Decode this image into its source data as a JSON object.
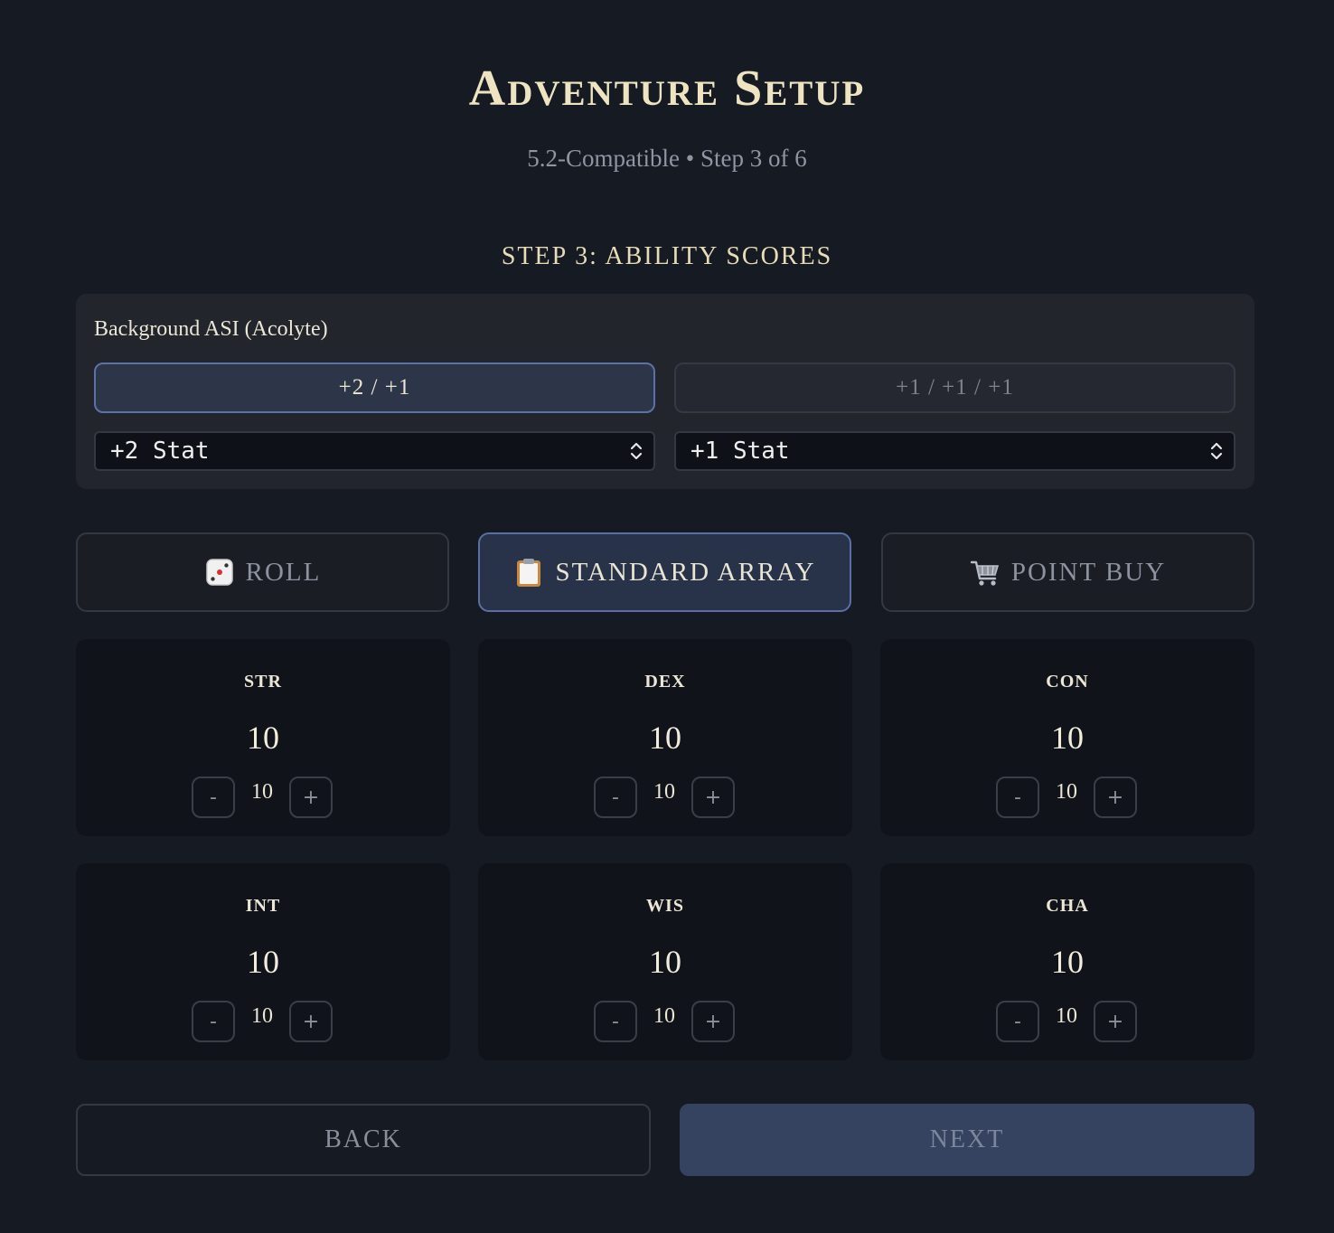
{
  "header": {
    "title": "Adventure Setup",
    "subtitle": "5.2-Compatible • Step 3 of 6"
  },
  "step": {
    "heading": "Step 3: Ability Scores"
  },
  "asi": {
    "label": "Background ASI (Acolyte)",
    "options": [
      {
        "label": "+2 / +1",
        "selected": true
      },
      {
        "label": "+1 / +1 / +1",
        "selected": false
      }
    ],
    "selects": [
      {
        "value": "+2 Stat"
      },
      {
        "value": "+1 Stat"
      }
    ]
  },
  "methods": [
    {
      "label": "Roll",
      "icon": "dice-icon",
      "selected": false
    },
    {
      "label": "Standard Array",
      "icon": "clipboard-icon",
      "selected": true
    },
    {
      "label": "Point Buy",
      "icon": "shopping-cart-icon",
      "selected": false
    }
  ],
  "stats": [
    {
      "name": "STR",
      "value": "10",
      "input": "10"
    },
    {
      "name": "DEX",
      "value": "10",
      "input": "10"
    },
    {
      "name": "CON",
      "value": "10",
      "input": "10"
    },
    {
      "name": "INT",
      "value": "10",
      "input": "10"
    },
    {
      "name": "WIS",
      "value": "10",
      "input": "10"
    },
    {
      "name": "CHA",
      "value": "10",
      "input": "10"
    }
  ],
  "stepper": {
    "minus": "-",
    "plus": "+"
  },
  "nav": {
    "back": "Back",
    "next": "Next"
  },
  "colors": {
    "background": "#161a22",
    "accent": "#5b72a8",
    "title": "#efe4c2"
  }
}
